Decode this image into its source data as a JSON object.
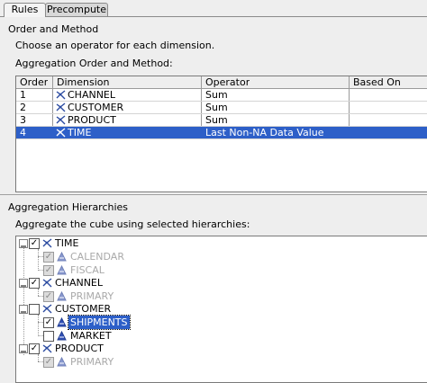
{
  "tabs": [
    {
      "label": "Rules",
      "active": true
    },
    {
      "label": "Precompute",
      "active": false
    }
  ],
  "section_order": "Order and Method",
  "instruction_order": "Choose an operator for each dimension.",
  "aggregation_order_label": "Aggregation Order and Method:",
  "table": {
    "columns": [
      "Order",
      "Dimension",
      "Operator",
      "Based On"
    ],
    "rows": [
      {
        "order": "1",
        "dimension": "CHANNEL",
        "operator": "Sum",
        "based_on": "",
        "selected": false
      },
      {
        "order": "2",
        "dimension": "CUSTOMER",
        "operator": "Sum",
        "based_on": "",
        "selected": false
      },
      {
        "order": "3",
        "dimension": "PRODUCT",
        "operator": "Sum",
        "based_on": "",
        "selected": false
      },
      {
        "order": "4",
        "dimension": "TIME",
        "operator": "Last Non-NA Data Value",
        "based_on": "",
        "selected": true
      }
    ]
  },
  "section_hier": "Aggregation Hierarchies",
  "instruction_hier": "Aggregate the cube using selected hierarchies:",
  "tree": [
    {
      "label": "TIME",
      "checked": true,
      "children": [
        {
          "label": "CALENDAR",
          "checked": true,
          "disabled": true
        },
        {
          "label": "FISCAL",
          "checked": true,
          "disabled": true
        }
      ]
    },
    {
      "label": "CHANNEL",
      "checked": true,
      "children": [
        {
          "label": "PRIMARY",
          "checked": true,
          "disabled": true
        }
      ]
    },
    {
      "label": "CUSTOMER",
      "checked": false,
      "children": [
        {
          "label": "SHIPMENTS",
          "checked": true,
          "disabled": false,
          "selected": true
        },
        {
          "label": "MARKET",
          "checked": false,
          "disabled": false
        }
      ]
    },
    {
      "label": "PRODUCT",
      "checked": true,
      "children": [
        {
          "label": "PRIMARY",
          "checked": true,
          "disabled": true
        }
      ]
    }
  ],
  "colors": {
    "selection": "#2d5fc8",
    "background": "#eeeeee",
    "hier_icon": "#3050b8"
  },
  "icons": {
    "dimension": "dimension-icon",
    "hierarchy": "hierarchy-icon"
  }
}
